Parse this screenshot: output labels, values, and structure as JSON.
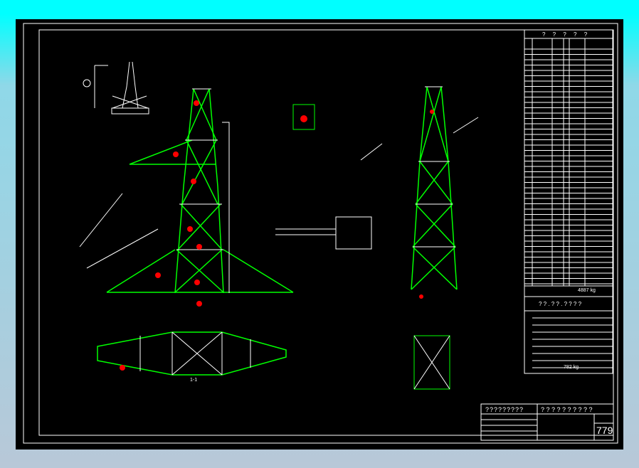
{
  "drawing": {
    "table_header": "? ? ? ? ?",
    "table_total": "4887 kg",
    "table2_header": "? ? . ? ? . ? ? ? ?",
    "table2_total": "782 kg",
    "section_label": "1-1",
    "title_left": "?????????",
    "title_right": "? ? ? ? ? ? ? ? ? ?",
    "sheet_number": "779"
  },
  "colors": {
    "line": "#ffffff",
    "member": "#00ff00",
    "mark": "#ff0000",
    "bg": "#000000"
  }
}
